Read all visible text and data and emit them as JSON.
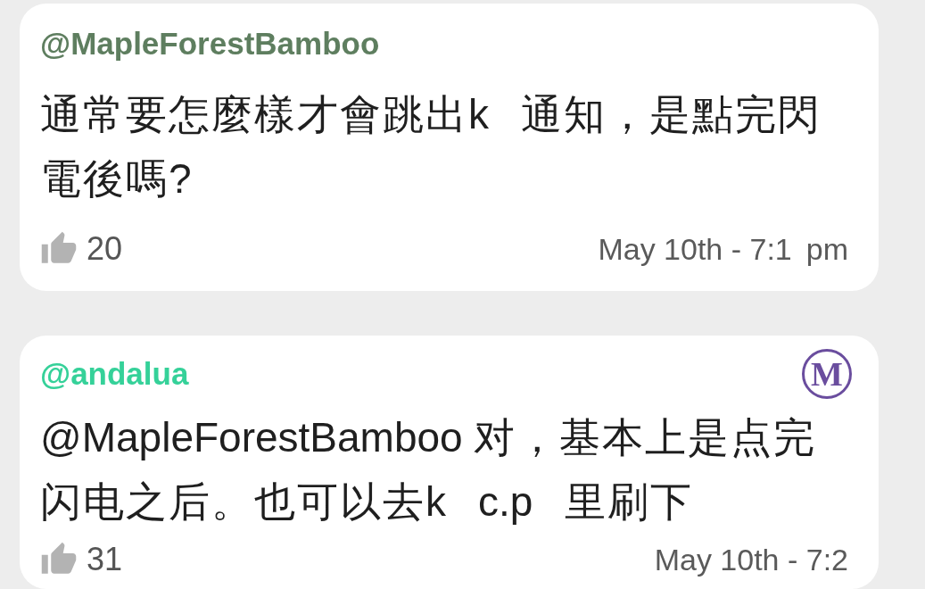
{
  "comments": [
    {
      "author": "@MapleForestBamboo",
      "color": "#5e7e5f",
      "body": [
        "通常要怎麼樣才會跳出k",
        "通知，是點完閃電後嗎?"
      ],
      "likes": "20",
      "time": [
        "May 10th - 7:1",
        "pm"
      ]
    },
    {
      "author": "@andalua",
      "color": "#35d199",
      "badge": "M",
      "body": [
        "@MapleForestBamboo 对，基本上是点完闪电之后。也可以去k",
        "c.p",
        "里刷下"
      ],
      "likes": "31",
      "time": [
        "May 10th - 7:2"
      ]
    }
  ]
}
